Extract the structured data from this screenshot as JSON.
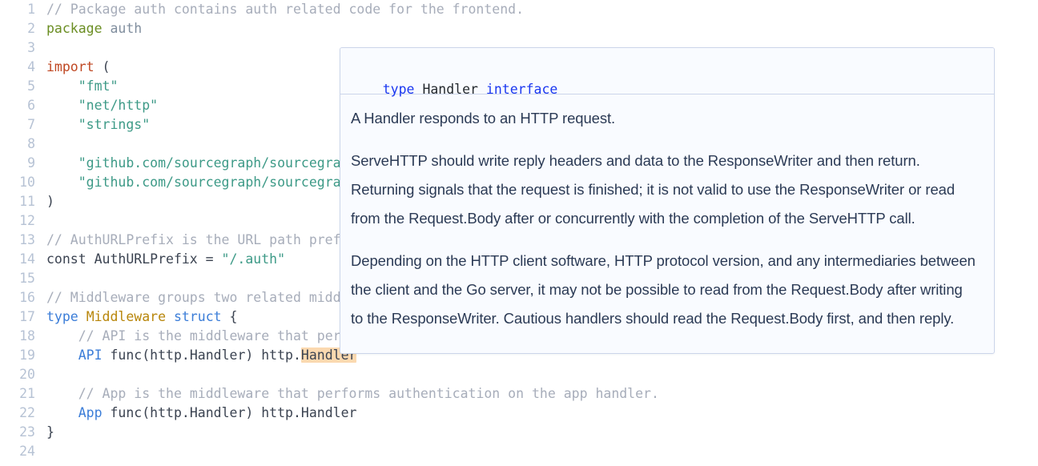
{
  "code_view": {
    "language": "go",
    "gutter_color": "#b6c2d4",
    "lines": [
      {
        "num": "1",
        "tokens": [
          {
            "t": "// Package auth contains auth related code for the frontend.",
            "c": "t-com"
          }
        ]
      },
      {
        "num": "2",
        "tokens": [
          {
            "t": "package",
            "c": "t-kw"
          },
          {
            "t": " ",
            "c": "t-pln"
          },
          {
            "t": "auth",
            "c": "t-id"
          }
        ]
      },
      {
        "num": "3",
        "tokens": []
      },
      {
        "num": "4",
        "tokens": [
          {
            "t": "import",
            "c": "t-imp"
          },
          {
            "t": " (",
            "c": "t-pln"
          }
        ]
      },
      {
        "num": "5",
        "tokens": [
          {
            "t": "    ",
            "c": "t-pln"
          },
          {
            "t": "\"fmt\"",
            "c": "t-str"
          }
        ]
      },
      {
        "num": "6",
        "tokens": [
          {
            "t": "    ",
            "c": "t-pln"
          },
          {
            "t": "\"net/http\"",
            "c": "t-str"
          }
        ]
      },
      {
        "num": "7",
        "tokens": [
          {
            "t": "    ",
            "c": "t-pln"
          },
          {
            "t": "\"strings\"",
            "c": "t-str"
          }
        ]
      },
      {
        "num": "8",
        "tokens": []
      },
      {
        "num": "9",
        "tokens": [
          {
            "t": "    ",
            "c": "t-pln"
          },
          {
            "t": "\"github.com/sourcegraph/sourcegraph/cmd/frontend/internal/app/router\"",
            "c": "t-str"
          }
        ]
      },
      {
        "num": "10",
        "tokens": [
          {
            "t": "    ",
            "c": "t-pln"
          },
          {
            "t": "\"github.com/sourcegraph/sourcegraph/cmd/frontend/internal/session\"",
            "c": "t-str"
          }
        ]
      },
      {
        "num": "11",
        "tokens": [
          {
            "t": ")",
            "c": "t-pln"
          }
        ]
      },
      {
        "num": "12",
        "tokens": []
      },
      {
        "num": "13",
        "tokens": [
          {
            "t": "// AuthURLPrefix is the URL path prefix under which to attach authentication handlers",
            "c": "t-com"
          }
        ]
      },
      {
        "num": "14",
        "tokens": [
          {
            "t": "const AuthURLPrefix = ",
            "c": "t-pln"
          },
          {
            "t": "\"/.auth\"",
            "c": "t-str"
          }
        ]
      },
      {
        "num": "15",
        "tokens": []
      },
      {
        "num": "16",
        "tokens": [
          {
            "t": "// Middleware groups two related middlewares (one for the API, one for the app).",
            "c": "t-com"
          }
        ]
      },
      {
        "num": "17",
        "tokens": [
          {
            "t": "type",
            "c": "t-blue"
          },
          {
            "t": " ",
            "c": "t-pln"
          },
          {
            "t": "Middleware",
            "c": "t-typ"
          },
          {
            "t": " ",
            "c": "t-pln"
          },
          {
            "t": "struct",
            "c": "t-blue"
          },
          {
            "t": " {",
            "c": "t-pln"
          }
        ]
      },
      {
        "num": "18",
        "tokens": [
          {
            "t": "    ",
            "c": "t-pln"
          },
          {
            "t": "// API is the middleware that performs authentication on the API handler.",
            "c": "t-com"
          }
        ]
      },
      {
        "num": "19",
        "tokens": [
          {
            "t": "    ",
            "c": "t-pln"
          },
          {
            "t": "API",
            "c": "t-blue"
          },
          {
            "t": " func(http.Handler) http.",
            "c": "t-pln"
          },
          {
            "t": "Handler",
            "c": "t-pln t-hl"
          }
        ]
      },
      {
        "num": "20",
        "tokens": []
      },
      {
        "num": "21",
        "tokens": [
          {
            "t": "    ",
            "c": "t-pln"
          },
          {
            "t": "// App is the middleware that performs authentication on the app handler.",
            "c": "t-com"
          }
        ]
      },
      {
        "num": "22",
        "tokens": [
          {
            "t": "    ",
            "c": "t-pln"
          },
          {
            "t": "App",
            "c": "t-blue"
          },
          {
            "t": " func(http.Handler) http.Handler",
            "c": "t-pln"
          }
        ]
      },
      {
        "num": "23",
        "tokens": [
          {
            "t": "}",
            "c": "t-pln"
          }
        ]
      },
      {
        "num": "24",
        "tokens": []
      }
    ]
  },
  "hover_tooltip": {
    "signature": {
      "keyword_1": "type",
      "name": "Handler",
      "keyword_2": "interface",
      "keyword_color": "#1a37f0",
      "name_color": "#24292e"
    },
    "documentation": [
      "A Handler responds to an HTTP request.",
      "ServeHTTP should write reply headers and data to the ResponseWriter and then return. Returning signals that the request is finished; it is not valid to use the ResponseWriter or read from the Request.Body after or concurrently with the completion of the ServeHTTP call.",
      "Depending on the HTTP client software, HTTP protocol version, and any intermediaries between the client and the Go server, it may not be possible to read from the Request.Body after writing to the ResponseWriter. Cautious handlers should read the Request.Body first, and then reply."
    ],
    "border_color": "#ccd5ea",
    "background_color": "#f9fbff"
  },
  "highlight": {
    "token": "Handler",
    "background_color": "#fbd9b0",
    "line": "19"
  }
}
